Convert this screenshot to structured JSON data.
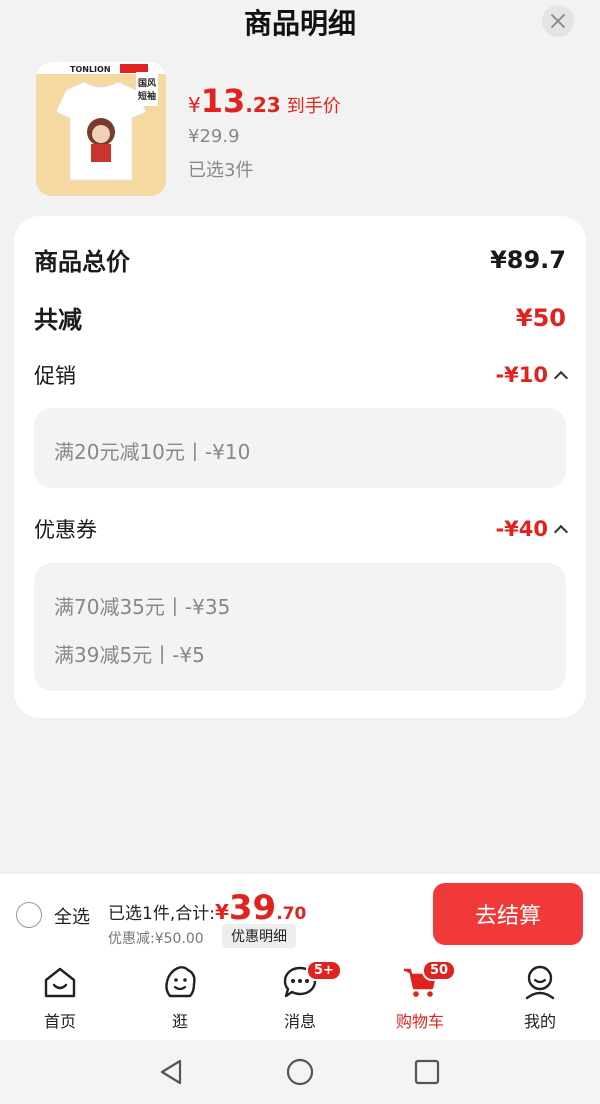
{
  "header": {
    "title": "商品明细"
  },
  "product": {
    "price_symbol": "¥",
    "price_int": "13",
    "price_dec": ".23",
    "price_label": "到手价",
    "original_price": "¥29.9",
    "selected_count": "已选3件",
    "thumb_brand": "TONLION",
    "thumb_tag": "国风短袖"
  },
  "summary": {
    "total_label": "商品总价",
    "total_value": "¥89.7",
    "reduce_label": "共减",
    "reduce_value": "¥50",
    "promo_label": "促销",
    "promo_value": "-¥10",
    "promo_items": [
      "满20元减10元丨-¥10"
    ],
    "coupon_label": "优惠券",
    "coupon_value": "-¥40",
    "coupon_items": [
      "满70减35元丨-¥35",
      "满39减5元丨-¥5"
    ]
  },
  "footer": {
    "select_all": "全选",
    "total_prefix": "已选1件,合计:",
    "total_symbol": "¥",
    "total_int": "39",
    "total_dec": ".70",
    "discount_text": "优惠减:¥50.00",
    "detail_button": "优惠明细",
    "checkout_button": "去结算"
  },
  "tabbar": {
    "tabs": [
      {
        "label": "首页"
      },
      {
        "label": "逛"
      },
      {
        "label": "消息",
        "badge": "5+"
      },
      {
        "label": "购物车",
        "badge": "50"
      },
      {
        "label": "我的"
      }
    ]
  },
  "colors": {
    "accent": "#e0231f",
    "checkout": "#f2393a",
    "muted": "#888888"
  }
}
